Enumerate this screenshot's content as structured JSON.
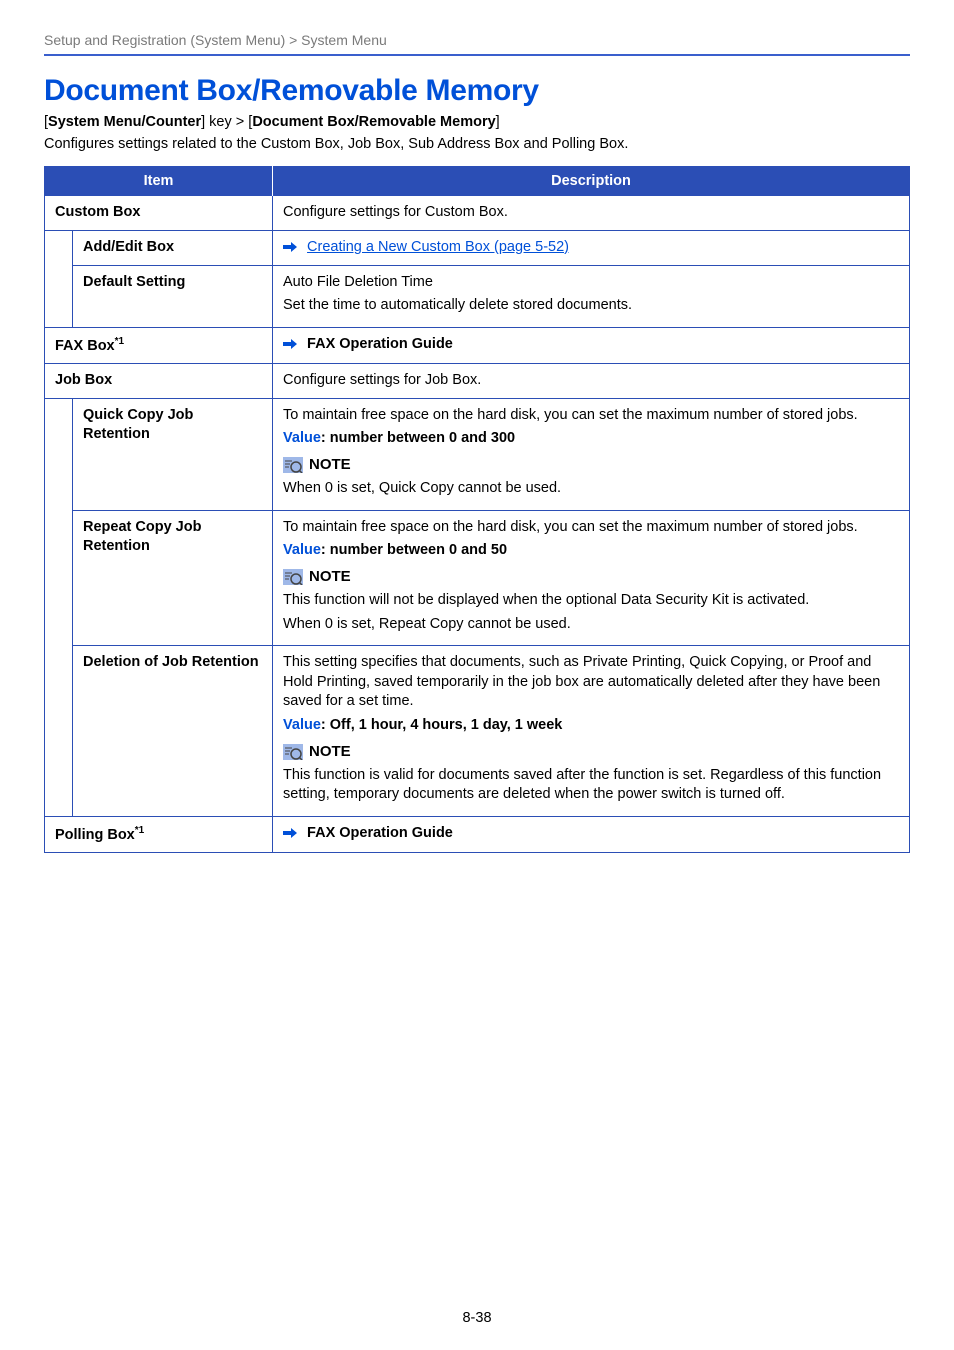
{
  "header": "Setup and Registration (System Menu) > System Menu",
  "title": "Document Box/Removable Memory",
  "subnav_parts": [
    "[",
    "System Menu/Counter",
    "] key > [",
    "Document Box/Removable Memory",
    "]"
  ],
  "intro": "Configures settings related to the Custom Box, Job Box, Sub Address Box and Polling Box.",
  "col_headers": {
    "item": "Item",
    "desc": "Description"
  },
  "rows": {
    "custom_box": {
      "label": "Custom Box",
      "desc": "Configure settings for Custom Box."
    },
    "add_edit": {
      "label": "Add/Edit Box",
      "link": "Creating a New Custom Box (page 5-52)"
    },
    "default_setting": {
      "label": "Default Setting",
      "line1": "Auto File Deletion Time",
      "line2": "Set the time to automatically delete stored documents."
    },
    "fax_box": {
      "label": "FAX Box",
      "sup": "*1",
      "ref": "FAX Operation Guide"
    },
    "job_box": {
      "label": "Job Box",
      "desc": "Configure settings for Job Box."
    },
    "quick_copy": {
      "label": "Quick Copy Job Retention",
      "desc": "To maintain free space on the hard disk, you can set the maximum number of stored jobs.",
      "value_label": "Value",
      "value_text": ": number between 0 and 300",
      "note_label": "NOTE",
      "note_text": "When 0 is set, Quick Copy cannot be used."
    },
    "repeat_copy": {
      "label": "Repeat Copy Job Retention",
      "desc": "To maintain free space on the hard disk, you can set the maximum number of stored jobs.",
      "value_label": "Value",
      "value_text": ": number between 0 and 50",
      "note_label": "NOTE",
      "note_text1": "This function will not be displayed when the optional Data Security Kit is activated.",
      "note_text2": "When 0 is set, Repeat Copy cannot be used."
    },
    "deletion": {
      "label": "Deletion of Job Retention",
      "desc": "This setting specifies that documents, such as Private Printing, Quick Copying, or Proof and Hold Printing, saved temporarily in the job box are automatically deleted after they have been saved for a set time.",
      "value_label": "Value",
      "value_text": ": Off, 1 hour, 4 hours, 1 day, 1 week",
      "note_label": "NOTE",
      "note_text": "This function is valid for documents saved after the function is set. Regardless of this function setting, temporary documents are deleted when the power switch is turned off."
    },
    "polling_box": {
      "label": "Polling Box",
      "sup": "*1",
      "ref": "FAX Operation Guide"
    }
  },
  "page_number": "8-38"
}
